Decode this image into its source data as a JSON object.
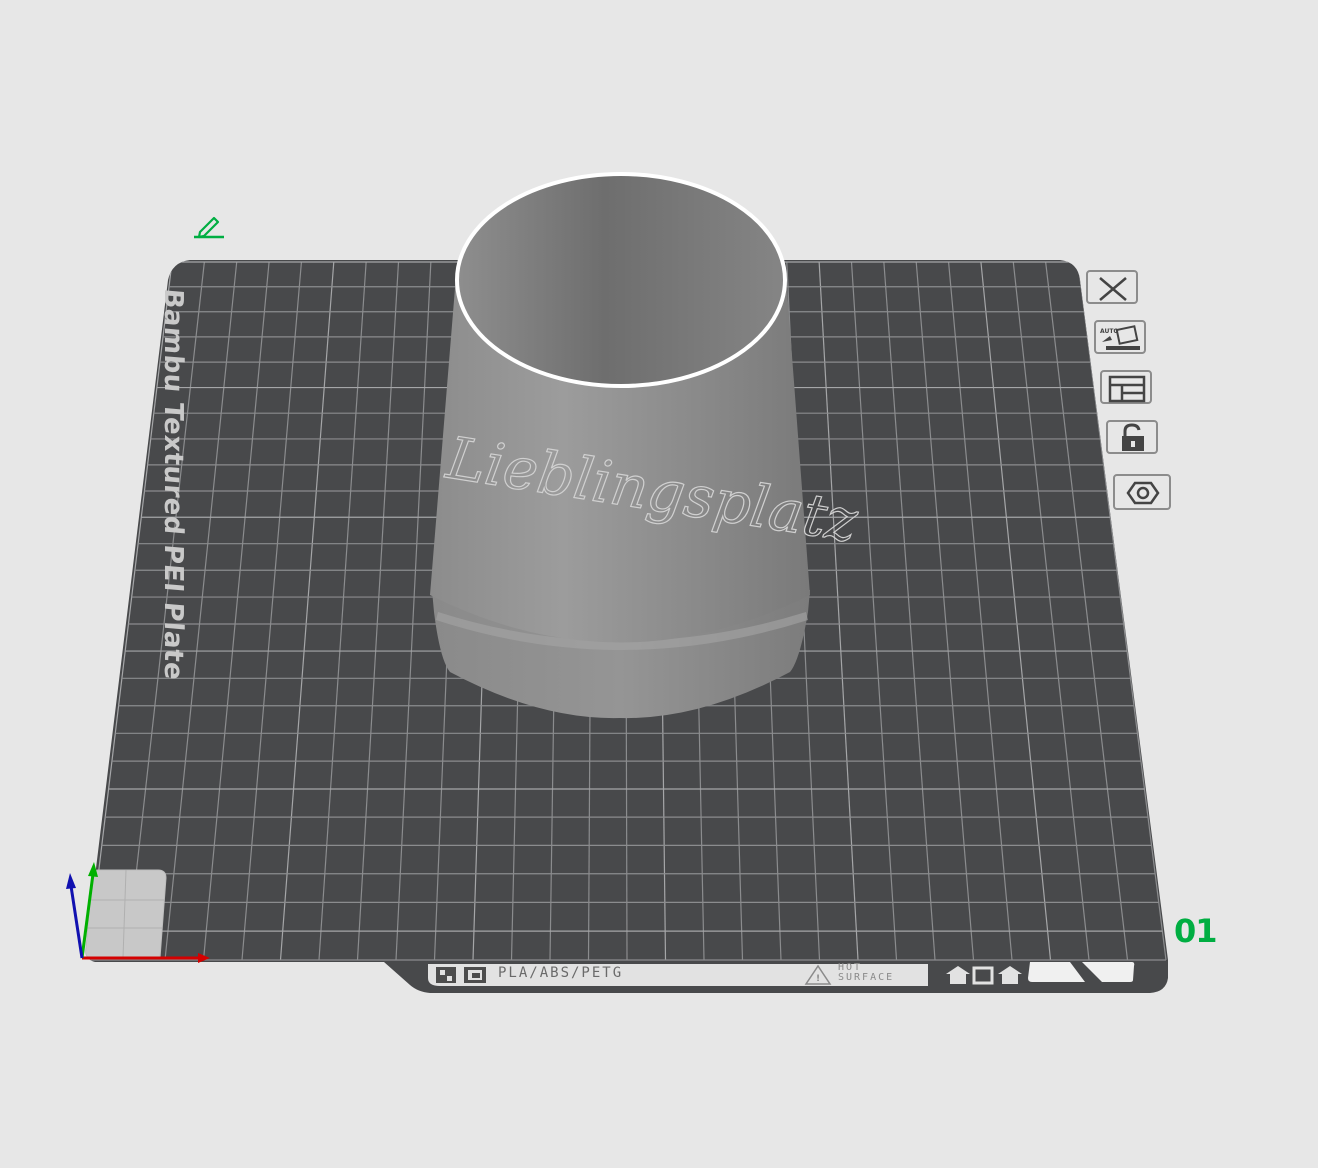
{
  "plate": {
    "name": "Bambu Textured PEI Plate",
    "number": "01",
    "material_label": "PLA/ABS/PETG",
    "hot_surface": [
      "HOT",
      "SURFACE"
    ]
  },
  "model": {
    "embossed_text": "Lieblingsplatz"
  },
  "toolbar": {
    "buttons": [
      "delete",
      "auto-orient",
      "arrange",
      "lock",
      "plate-settings"
    ]
  },
  "colors": {
    "background": "#e7e7e7",
    "plate": "#48494b",
    "grid": "#8b8c8e",
    "model": "#9a9a9a",
    "accent": "#00ae42",
    "axis_x": "#d40000",
    "axis_y": "#00b000",
    "axis_z": "#1010b0"
  }
}
